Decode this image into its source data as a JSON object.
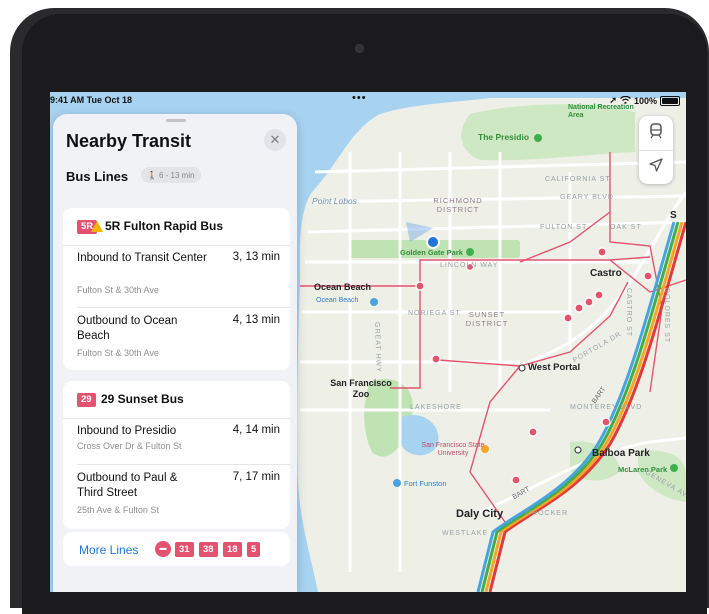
{
  "status_bar": {
    "time": "9:41 AM  Tue Oct 18",
    "dots": "•••",
    "battery": "100%"
  },
  "panel": {
    "title": "Nearby Transit",
    "close_glyph": "✕",
    "subhead": "Bus Lines",
    "walk_time": "6 - 13 min",
    "routes": [
      {
        "badge": "5R",
        "name": "5R Fulton Rapid Bus",
        "warning": true,
        "trips": [
          {
            "destination": "Inbound to Transit Center",
            "time": "3, 13 min",
            "stop": "Fulton St & 30th Ave"
          },
          {
            "destination": "Outbound to Ocean Beach",
            "time": "4, 13 min",
            "stop": "Fulton St & 30th Ave"
          }
        ]
      },
      {
        "badge": "29",
        "name": "29 Sunset Bus",
        "warning": false,
        "trips": [
          {
            "destination": "Inbound to Presidio",
            "time": "4, 14 min",
            "stop": "Cross Over Dr & Fulton St"
          },
          {
            "destination": "Outbound to Paul & Third Street",
            "time": "7, 17 min",
            "stop": "25th Ave & Fulton St"
          }
        ]
      }
    ],
    "more_lines": {
      "label": "More Lines",
      "badges": [
        "31",
        "38",
        "18",
        "5"
      ]
    }
  },
  "map": {
    "labels": {
      "presidio": "The Presidio",
      "national_rec": "National Recreation Area",
      "point_lobos": "Point Lobos",
      "richmond": "RICHMOND DISTRICT",
      "california_st": "CALIFORNIA ST",
      "geary_blvd": "GEARY BLVD",
      "fulton_st": "FULTON ST",
      "oak_st": "OAK ST",
      "gg_park": "Golden Gate Park",
      "lincoln_way": "LINCOLN WAY",
      "ocean_beach_1": "Ocean Beach",
      "ocean_beach_2": "Ocean Beach",
      "noriega_st": "NORIEGA ST",
      "sunset": "SUNSET DISTRICT",
      "great_hwy": "GREAT HWY",
      "castro": "Castro",
      "castro_st": "CASTRO ST",
      "dolores_st": "DOLORES ST",
      "portola": "PORTOLA DR",
      "west_portal": "West Portal",
      "sf_zoo": "San Francisco Zoo",
      "lakeshore": "LAKESHORE",
      "monterey": "MONTEREY BLVD",
      "sfsu": "San Francisco State University",
      "balboa": "Balboa Park",
      "mclaren": "McLaren Park",
      "fort_funston": "Fort Funston",
      "daly_city": "Daly City",
      "crocker": "CROCKER",
      "westlake": "WESTLAKE",
      "geneva": "GENEVA AVE",
      "bart": "BART",
      "edge_s": "S"
    }
  },
  "colors": {
    "accent": "#1f76d6",
    "route_red": "#e3536f",
    "water": "#a7d2f0",
    "park": "#bfe3b2",
    "land": "#eef0e8"
  }
}
